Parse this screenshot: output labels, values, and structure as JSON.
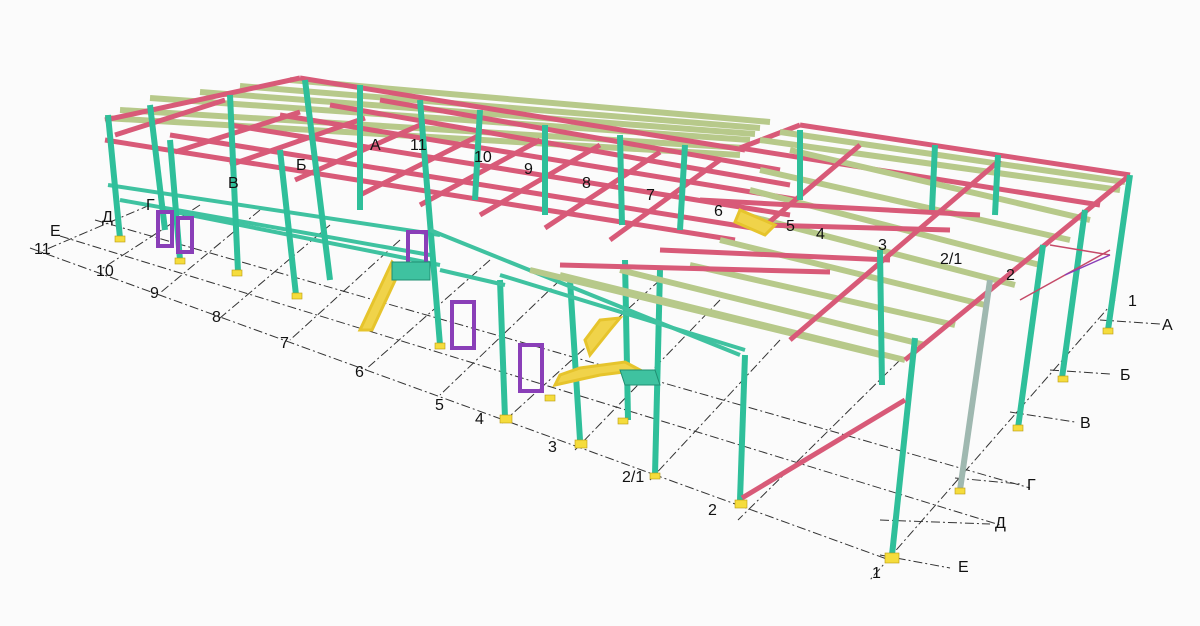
{
  "axes_letters_front": [
    "А",
    "Б",
    "В",
    "Г",
    "Д",
    "Е"
  ],
  "axes_numbers_front": [
    "1",
    "2",
    "2/1",
    "3",
    "4",
    "5",
    "6",
    "7",
    "8",
    "9",
    "10",
    "11"
  ],
  "labels": {
    "A_right": "А",
    "B_right": "Б",
    "V_right": "В",
    "G_right": "Г",
    "D_right": "Д",
    "E_right": "Е",
    "n1_right": "1",
    "n1_bottom": "1",
    "n2_bottom": "2",
    "n21_bottom": "2/1",
    "n3_bottom": "3",
    "n4_bottom": "4",
    "n5_bottom": "5",
    "n6_bottom": "6",
    "n7_bottom": "7",
    "n8_bottom": "8",
    "n9_bottom": "9",
    "n10_bottom": "10",
    "n11_left": "11",
    "E_left": "Е",
    "D_left": "Д",
    "G_left": "Г",
    "V_top": "В",
    "B_top": "Б",
    "A_top": "А",
    "n11_top": "11",
    "n10_top": "10",
    "n9_top": "9",
    "n8_top": "8",
    "n7_top": "7",
    "n6_top": "6",
    "n5_top": "5",
    "n4_top": "4",
    "n3_top": "3",
    "n21_top": "2/1",
    "n2_top": "2"
  },
  "colors": {
    "columns": "#2fbf9a",
    "main_beams": "#d85a78",
    "purlins": "#b7c98a",
    "bracing": "#8a3fb8",
    "stairs": "#f0d34a",
    "background": "#fbfbfb"
  }
}
